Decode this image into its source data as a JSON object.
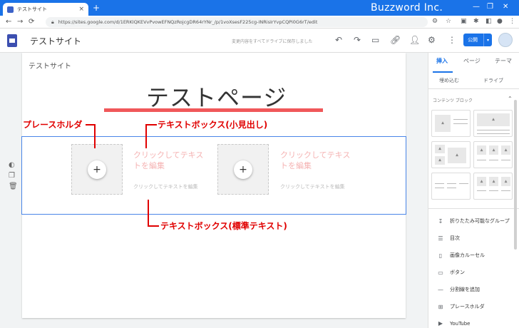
{
  "browser": {
    "tab_title": "テストサイト",
    "tab_close": "×",
    "new_tab": "+",
    "brand": "Buzzword Inc.",
    "url": "https://sites.google.com/d/1ERKIQKEVvPvowEFNQzRojcgDR64rYNr_/p/1voXsesF225cg-INRisIrYvpCQPi0G6rT/edit",
    "controls": {
      "minimize": "—",
      "maximize": "❐",
      "close": "✕"
    },
    "nav": {
      "back": "←",
      "forward": "→",
      "reload": "⟳"
    }
  },
  "header": {
    "site_name": "テストサイト",
    "save_status": "変更内容をすべてドライブに保存しました",
    "publish_label": "公開",
    "publish_dropdown": "▾"
  },
  "page": {
    "site_label": "テストサイト",
    "title": "テストページ",
    "section": {
      "heading_placeholder_1": "クリックしてテキストを編集",
      "body_placeholder_1": "クリックしてテキストを編集",
      "heading_placeholder_2": "クリックしてテキストを編集",
      "body_placeholder_2": "クリックしてテキストを編集",
      "plus": "+"
    }
  },
  "annotations": {
    "placeholder": "プレースホルダ",
    "textbox_heading": "テキストボックス(小見出し)",
    "textbox_body": "テキストボックス(標準テキスト)"
  },
  "panel": {
    "tabs": [
      "挿入",
      "ページ",
      "テーマ"
    ],
    "sub": [
      "埋め込む",
      "ドライブ"
    ],
    "content_blocks_header": "コンテンツ ブロック",
    "items": [
      {
        "icon": "collapsible-group-icon",
        "glyph": "↧",
        "label": "折りたたみ可能なグループ"
      },
      {
        "icon": "toc-icon",
        "glyph": "☰",
        "label": "目次"
      },
      {
        "icon": "carousel-icon",
        "glyph": "▯",
        "label": "画像カルーセル"
      },
      {
        "icon": "button-icon",
        "glyph": "▭",
        "label": "ボタン"
      },
      {
        "icon": "divider-icon",
        "glyph": "—",
        "label": "分割線を追加"
      },
      {
        "icon": "placeholder-icon",
        "glyph": "⊞",
        "label": "プレースホルダ"
      },
      {
        "icon": "youtube-icon",
        "glyph": "▶",
        "label": "YouTube"
      }
    ]
  },
  "colors": {
    "accent": "#1a73e8",
    "annotation": "#e00000",
    "title_underline": "#f0585a",
    "placeholder_text": "#f5b3b3"
  }
}
